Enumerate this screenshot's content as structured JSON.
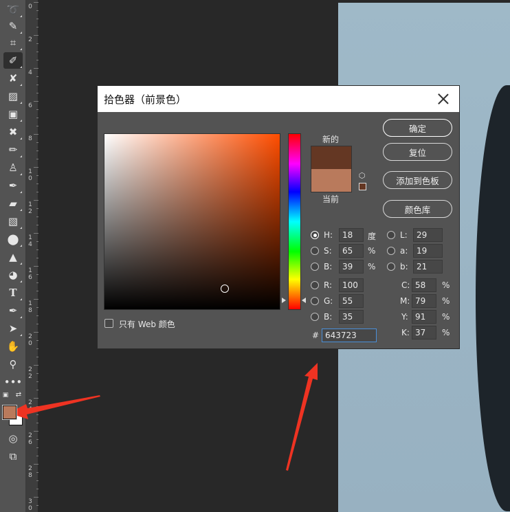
{
  "dialog": {
    "title": "拾色器（前景色）",
    "new_label": "新的",
    "current_label": "当前",
    "buttons": {
      "ok": "确定",
      "reset": "复位",
      "add_to_swatches": "添加到色板",
      "color_libraries": "颜色库"
    },
    "fields": {
      "H": {
        "label": "H:",
        "value": "18",
        "unit": "度"
      },
      "S": {
        "label": "S:",
        "value": "65",
        "unit": "%"
      },
      "Bv": {
        "label": "B:",
        "value": "39",
        "unit": "%"
      },
      "R": {
        "label": "R:",
        "value": "100"
      },
      "G": {
        "label": "G:",
        "value": "55"
      },
      "Bb": {
        "label": "B:",
        "value": "35"
      },
      "L": {
        "label": "L:",
        "value": "29"
      },
      "a": {
        "label": "a:",
        "value": "19"
      },
      "b": {
        "label": "b:",
        "value": "21"
      },
      "C": {
        "label": "C:",
        "value": "58",
        "unit": "%"
      },
      "M": {
        "label": "M:",
        "value": "79",
        "unit": "%"
      },
      "Y": {
        "label": "Y:",
        "value": "91",
        "unit": "%"
      },
      "K": {
        "label": "K:",
        "value": "37",
        "unit": "%"
      }
    },
    "hex_label": "#",
    "hex_value": "643723",
    "web_only_label": "只有 Web 颜色",
    "new_color": "#643723",
    "current_color": "#b97a5c",
    "hue_base": "#ff4d00"
  },
  "ruler": {
    "labels": [
      "0",
      "2",
      "4",
      "6",
      "8",
      "1\n0",
      "1\n2",
      "1\n4",
      "1\n6",
      "1\n8",
      "2\n0",
      "2\n2",
      "2\n4",
      "2\n6",
      "2\n8",
      "3\n0"
    ]
  },
  "toolbar": {
    "tools": [
      "lasso-icon",
      "quick-select-icon",
      "crop-icon",
      "eyedropper-icon",
      "healing-brush-icon",
      "eraser-alt-icon",
      "frame-icon",
      "content-move-icon",
      "brush-icon",
      "stamp-icon",
      "history-brush-icon",
      "eraser-icon",
      "gradient-icon",
      "blur-icon",
      "sharpen-icon",
      "dodge-icon",
      "text-icon",
      "pen-icon",
      "path-select-icon",
      "hand-icon",
      "zoom-icon",
      "more-icon"
    ],
    "foreground_color": "#b97a5c",
    "background_color": "#ffffff"
  },
  "annotation_color": "#ee3322"
}
